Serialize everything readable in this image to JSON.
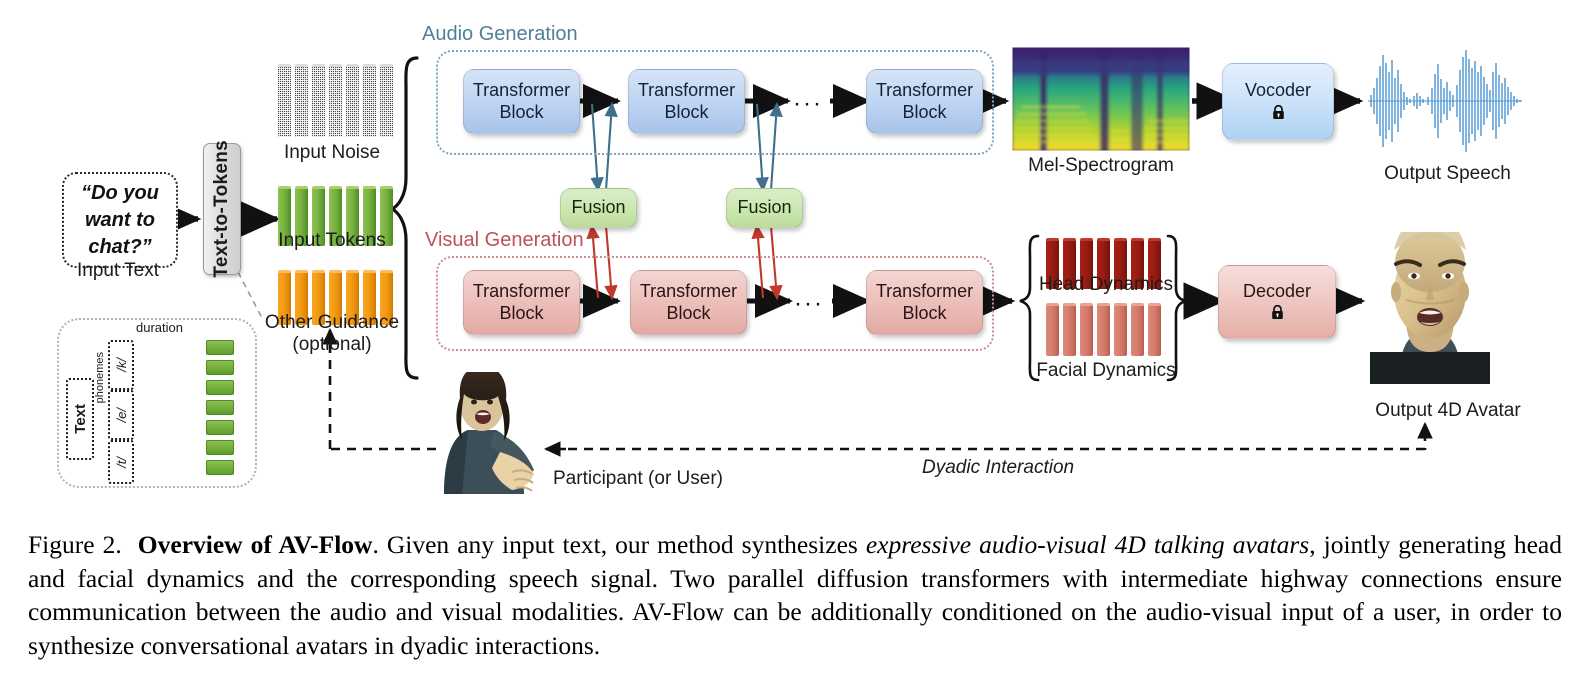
{
  "figure": {
    "number": "Figure 2.",
    "title": "Overview of AV-Flow",
    "sentence1_a": ". Given any input text, our method synthesizes ",
    "sentence1_em": "expressive audio-visual 4D talking avatars",
    "sentence1_b": ", jointly generating head and facial dynamics and the corresponding speech signal. Two parallel diffusion transformers with intermediate highway connections ensure communication between the audio and visual modalities. AV-Flow can be additionally conditioned on the audio-visual input of a user, in order to synthesize conversational avatars in dyadic interactions."
  },
  "input": {
    "prompt_line1": "“Do you",
    "prompt_line2": "want to",
    "prompt_line3": "chat?”",
    "prompt_caption": "Input Text",
    "text_to_tokens": "Text-to-Tokens"
  },
  "inset": {
    "text_label": "Text",
    "phonemes_label": "phonemes",
    "duration_label": "duration",
    "phonemes": [
      "/k/",
      "/e/",
      "/t/"
    ],
    "token_count": 7
  },
  "tokens": {
    "noise_label": "Input Noise",
    "noise_count": 7,
    "tokens_label": "Input Tokens",
    "tokens_count": 7,
    "guidance_label_line1": "Other Guidance",
    "guidance_label_line2": "(optional)",
    "guidance_count": 7
  },
  "audio_branch": {
    "section_label": "Audio Generation",
    "accent_color": "#4e7f98",
    "blocks": [
      {
        "line1": "Transformer",
        "line2": "Block"
      },
      {
        "line1": "Transformer",
        "line2": "Block"
      },
      {
        "line1": "Transformer",
        "line2": "Block"
      }
    ],
    "ellipsis": "···",
    "mel_label": "Mel-Spectrogram",
    "vocoder_label": "Vocoder",
    "vocoder_lock": "🔒",
    "output_label": "Output Speech"
  },
  "visual_branch": {
    "section_label": "Visual Generation",
    "accent_color": "#c05252",
    "blocks": [
      {
        "line1": "Transformer",
        "line2": "Block"
      },
      {
        "line1": "Transformer",
        "line2": "Block"
      },
      {
        "line1": "Transformer",
        "line2": "Block"
      }
    ],
    "ellipsis": "···",
    "head_dynamics_label": "Head Dynamics",
    "head_dynamics_count": 7,
    "facial_dynamics_label": "Facial Dynamics",
    "facial_dynamics_count": 7,
    "decoder_label": "Decoder",
    "decoder_lock": "🔒",
    "output_label": "Output 4D Avatar"
  },
  "fusion": {
    "label": "Fusion",
    "count": 2
  },
  "feedback": {
    "participant_label": "Participant (or User)",
    "dyadic_label": "Dyadic Interaction"
  }
}
